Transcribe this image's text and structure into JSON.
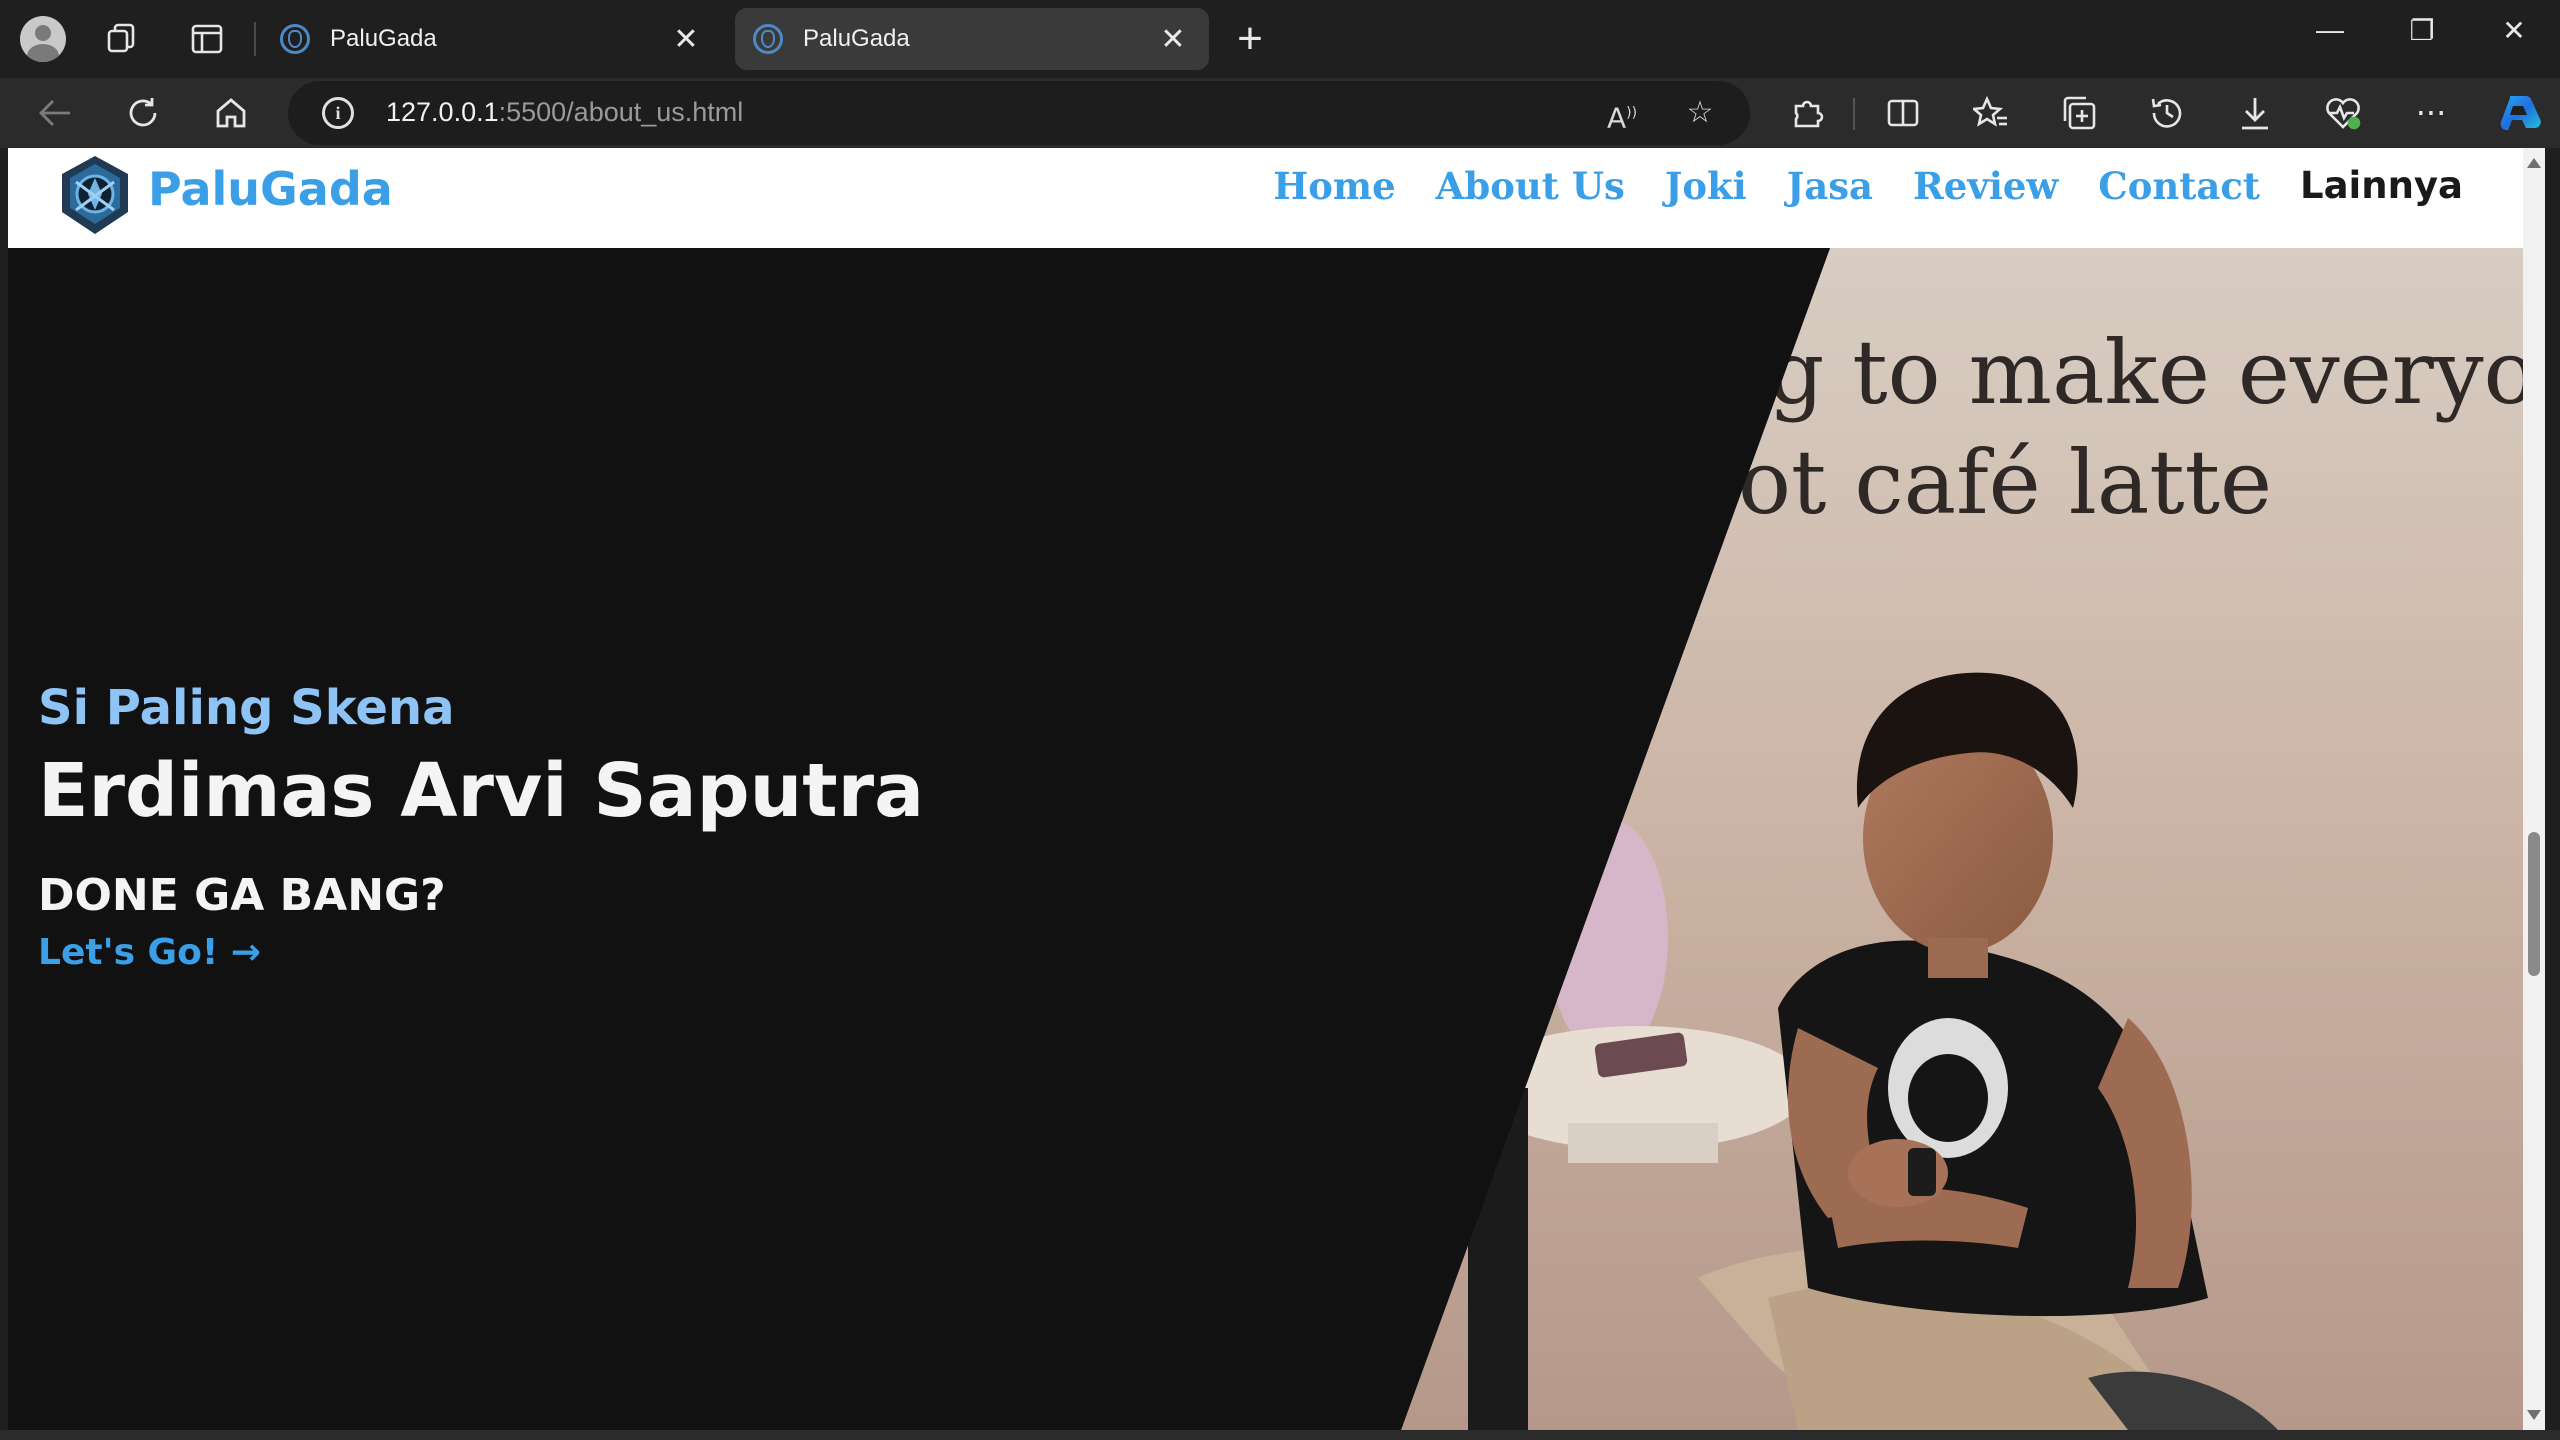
{
  "browser": {
    "tabs": [
      {
        "title": "PaluGada",
        "active": false
      },
      {
        "title": "PaluGada",
        "active": true
      }
    ],
    "new_tab_icon": "plus-icon",
    "window_controls": {
      "minimize": "—",
      "restore": "❐",
      "close": "✕"
    },
    "address": {
      "host": "127.0.0.1",
      "path": ":5500/about_us.html"
    },
    "toolbar_icons": [
      "back-icon",
      "refresh-icon",
      "home-icon",
      "read-aloud-icon",
      "favorite-star-icon",
      "extensions-icon",
      "split-screen-icon",
      "favorites-icon",
      "collections-icon",
      "history-icon",
      "downloads-icon",
      "browser-essentials-icon",
      "more-icon",
      "copilot-icon"
    ]
  },
  "site": {
    "brand": "PaluGada",
    "nav": [
      {
        "label": "Home",
        "style": "accent"
      },
      {
        "label": "About Us",
        "style": "accent"
      },
      {
        "label": "Joki",
        "style": "accent"
      },
      {
        "label": "Jasa",
        "style": "accent"
      },
      {
        "label": "Review",
        "style": "accent"
      },
      {
        "label": "Contact",
        "style": "accent"
      },
      {
        "label": "Lainnya",
        "style": "dark"
      }
    ],
    "colors": {
      "accent": "#3b9fe8",
      "subtitle": "#8ec3f5",
      "hero_bg": "#111112"
    }
  },
  "hero": {
    "subtitle": "Si Paling Skena",
    "name": "Erdimas Arvi Saputra",
    "tagline": "DONE GA BANG?",
    "cta": "Let's Go! →",
    "photo_wall_text": [
      "g to make everyo",
      "ot café latte"
    ]
  }
}
